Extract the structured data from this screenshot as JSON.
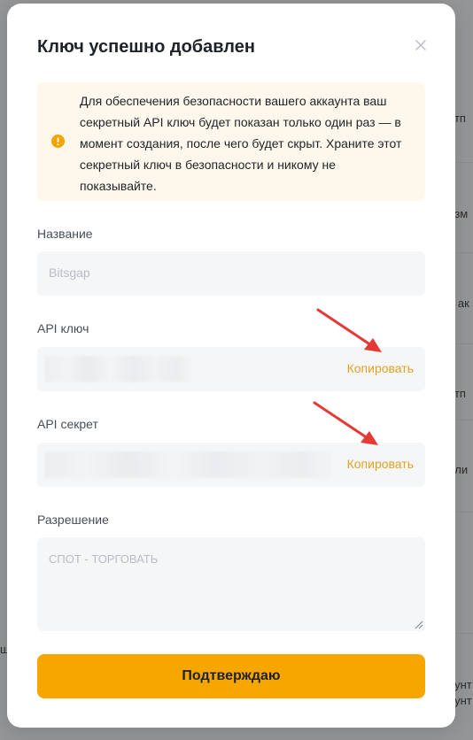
{
  "modal": {
    "title": "Ключ успешно добавлен",
    "warning": "Для обеспечения безопасности вашего аккаунта ваш секретный API ключ будет показан только один раз — в момент создания, после чего будет скрыт. Храните этот секретный ключ в безопасности и никому не показывайте.",
    "name_label": "Название",
    "name_placeholder": "Bitsgap",
    "api_key_label": "API ключ",
    "api_key_copy": "Копировать",
    "api_secret_label": "API секрет",
    "api_secret_copy": "Копировать",
    "permission_label": "Разрешение",
    "permission_value": "СПОТ - ТОРГОВАТЬ",
    "confirm_label": "Подтверждаю"
  },
  "background": {
    "fragments": [
      "отп",
      "изм",
      "и ак",
      "отп",
      "или",
      "аунт",
      "аунт"
    ],
    "left_fragment": "ш"
  },
  "colors": {
    "accent": "#f7a600",
    "link": "#e0a325",
    "warning_bg": "#fef8ec",
    "annotation_arrow": "#e53935"
  },
  "icons": {
    "close": "close-icon",
    "warning": "warning-circle-icon",
    "annotation": "red-arrow-icon"
  }
}
